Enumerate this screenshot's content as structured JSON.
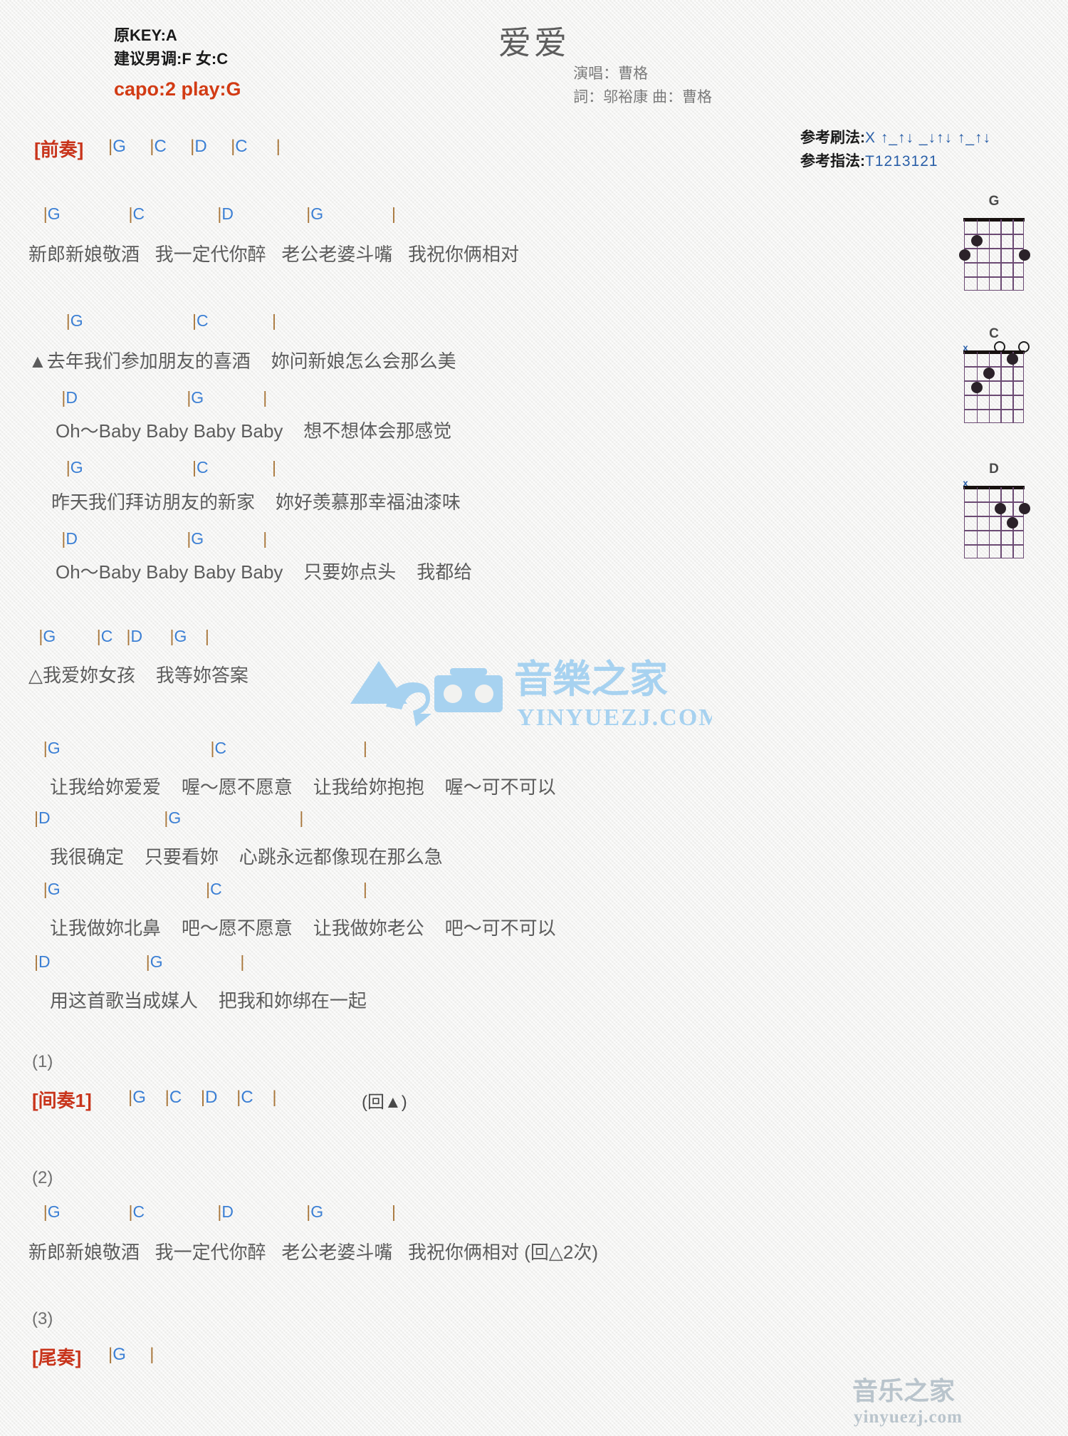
{
  "header": {
    "title": "爱爱",
    "orig_key": "原KEY:A",
    "suggest_key": "建议男调:F 女:C",
    "capo": "capo:2 play:G",
    "singer": "演唱：曹格",
    "writers": "詞：邬裕康   曲：曹格",
    "strum_label": "参考刷法:",
    "strum_value": "X ↑_↑↓ _↓↑↓ ↑_↑↓",
    "finger_label": "参考指法:",
    "finger_value": "T1213121"
  },
  "intro": {
    "tag": "[前奏]",
    "chords": "|G     |C     |D     |C      |"
  },
  "verse1": {
    "chords": "  |G               |C                |D                |G               |",
    "lyrics": "新郎新娘敬酒   我一定代你醉   老公老婆斗嘴   我祝你俩相对"
  },
  "verseA": [
    {
      "chords": "       |G                        |C              |",
      "lyrics": "▲去年我们参加朋友的喜酒    妳问新娘怎么会那么美"
    },
    {
      "chords": "      |D                        |G             |",
      "lyrics": "Oh～Baby Baby Baby Baby    想不想体会那感觉"
    },
    {
      "chords": "       |G                        |C              |",
      "lyrics": "昨天我们拜访朋友的新家    妳好羡慕那幸福油漆味"
    },
    {
      "chords": "      |D                        |G             |",
      "lyrics": "Oh～Baby Baby Baby Baby    只要妳点头    我都给"
    }
  ],
  "chorusTriangle": {
    "chords": " |G         |C   |D      |G    |",
    "lyrics": "△我爱妳女孩    我等妳答案"
  },
  "chorus": [
    {
      "chords": "  |G                                 |C                              |",
      "lyrics": "让我给妳爱爱    喔～愿不愿意    让我给妳抱抱    喔～可不可以"
    },
    {
      "chords": "|D                         |G                          |",
      "lyrics": "我很确定    只要看妳    心跳永远都像现在那么急"
    },
    {
      "chords": "  |G                                |C                               |",
      "lyrics": "让我做妳北鼻    吧～愿不愿意    让我做妳老公    吧～可不可以"
    },
    {
      "chords": "|D                     |G                 |",
      "lyrics": "用这首歌当成媒人    把我和妳绑在一起"
    }
  ],
  "section1": {
    "number": "(1)",
    "tag": "[间奏1]",
    "chords": "|G    |C    |D    |C    |",
    "note": "(回▲)"
  },
  "section2": {
    "number": "(2)",
    "chords": "  |G               |C                |D                |G               |",
    "lyrics": "新郎新娘敬酒   我一定代你醉   老公老婆斗嘴   我祝你俩相对",
    "note": " (回△2次)"
  },
  "section3": {
    "number": "(3)",
    "tag": "[尾奏]",
    "chords": "|G     |"
  },
  "chord_diagrams": [
    {
      "name": "G",
      "markers": [
        {
          "type": "dot",
          "string": 5,
          "fret": 2
        },
        {
          "type": "dot",
          "string": 6,
          "fret": 3
        },
        {
          "type": "dot",
          "string": 1,
          "fret": 3
        }
      ],
      "top": []
    },
    {
      "name": "C",
      "markers": [
        {
          "type": "dot",
          "string": 2,
          "fret": 1
        },
        {
          "type": "dot",
          "string": 4,
          "fret": 2
        },
        {
          "type": "dot",
          "string": 5,
          "fret": 3
        }
      ],
      "top": [
        {
          "type": "x",
          "string": 6
        },
        {
          "type": "open",
          "string": 3
        },
        {
          "type": "open",
          "string": 1
        }
      ]
    },
    {
      "name": "D",
      "markers": [
        {
          "type": "dot",
          "string": 3,
          "fret": 2
        },
        {
          "type": "dot",
          "string": 1,
          "fret": 2
        },
        {
          "type": "dot",
          "string": 2,
          "fret": 3
        }
      ],
      "top": [
        {
          "type": "x",
          "string": 6
        }
      ]
    }
  ],
  "watermark": {
    "brand_cn": "音樂之家",
    "brand_url": "YINYUEZJ.COM",
    "corner_cn": "音乐之家",
    "corner_url": "yinyuezj.com",
    "color": "#a7d2f0"
  }
}
